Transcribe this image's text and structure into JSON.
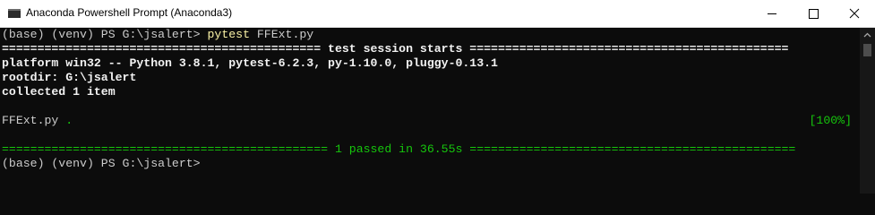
{
  "window": {
    "title": "Anaconda Powershell Prompt (Anaconda3)",
    "controls": [
      "minimize-icon",
      "maximize-icon",
      "close-icon"
    ]
  },
  "console": {
    "line1": {
      "prompt": "(base) (venv) PS G:\\jsalert> ",
      "command": "pytest",
      "args": " FFExt.py"
    },
    "line2": "============================================= test session starts =============================================",
    "line3": "platform win32 -- Python 3.8.1, pytest-6.2.3, py-1.10.0, pluggy-0.13.1",
    "line4": "rootdir: G:\\jsalert",
    "line5": "collected 1 item",
    "line7": {
      "file": "FFExt.py ",
      "progress": ".",
      "percent": "[100%]"
    },
    "line9": "============================================== 1 passed in 36.55s ==============================================",
    "line10": "(base) (venv) PS G:\\jsalert>"
  },
  "colors": {
    "background": "#0c0c0c",
    "text": "#cccccc",
    "command": "#f9f1a5",
    "pass": "#16c60c"
  }
}
